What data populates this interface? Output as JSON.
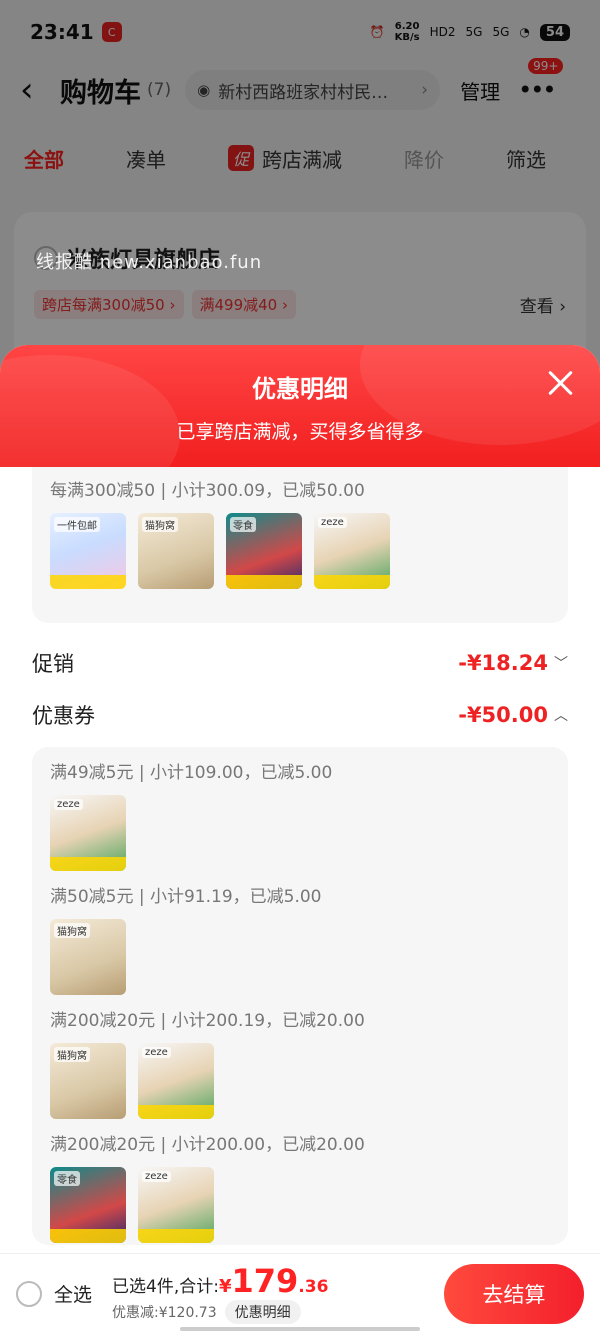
{
  "status_bar": {
    "time": "23:41",
    "app_badge": "C",
    "net_speed_top": "6.20",
    "net_speed_unit": "KB/s",
    "signal_1": "HD2",
    "signal_2": "5G",
    "signal_3": "5G",
    "battery": "54"
  },
  "header": {
    "title": "购物车",
    "count": "(7)",
    "address": "新村西路班家村村民…",
    "manage": "管理",
    "more_badge": "99+"
  },
  "tabs": [
    {
      "label": "全部"
    },
    {
      "label": "凑单"
    },
    {
      "label": "跨店满减",
      "tag": "促"
    },
    {
      "label": "降价"
    },
    {
      "label": "筛选"
    }
  ],
  "store": {
    "name": "米族灯具旗舰店",
    "tags": [
      "跨店每满300减50 ›",
      "满499减40 ›"
    ],
    "view_more": "查看 ›"
  },
  "watermark": "线报酷 new.xianbao.fun",
  "sheet": {
    "title": "优惠明细",
    "subtitle": "已享跨店满减，买得多省得多",
    "top_group": {
      "rule": "每满300减50 | 小计300.09，已减50.00",
      "thumbs": [
        {
          "kind": "tissue-pack-icon",
          "label": "一件包邮"
        },
        {
          "kind": "pet-house-icon",
          "label": "猫狗窝"
        },
        {
          "kind": "pet-snack-icon",
          "label": "零食"
        },
        {
          "kind": "deer-pet-bed-icon",
          "label": "zeze"
        }
      ]
    },
    "promo": {
      "label": "促销",
      "amount": "-¥18.24"
    },
    "coupon": {
      "label": "优惠券",
      "amount": "-¥50.00"
    },
    "coupon_groups": [
      {
        "rule": "满49减5元 | 小计109.00，已减5.00",
        "thumbs": [
          {
            "kind": "deer-pet-bed-icon",
            "label": "zeze"
          }
        ]
      },
      {
        "rule": "满50减5元 | 小计91.19，已减5.00",
        "thumbs": [
          {
            "kind": "pet-house-icon",
            "label": "猫狗窝"
          }
        ]
      },
      {
        "rule": "满200减20元 | 小计200.19，已减20.00",
        "thumbs": [
          {
            "kind": "pet-house-icon",
            "label": "猫狗窝"
          },
          {
            "kind": "deer-pet-bed-icon",
            "label": "zeze"
          }
        ]
      },
      {
        "rule": "满200减20元 | 小计200.00，已减20.00",
        "thumbs": [
          {
            "kind": "pet-snack-icon",
            "label": "零食"
          },
          {
            "kind": "deer-pet-bed-icon",
            "label": "zeze"
          }
        ]
      }
    ]
  },
  "bottom": {
    "select_all": "全选",
    "selected_total": "已选4件,合计:",
    "price_symbol": "¥",
    "price_int": "179",
    "price_dec": ".36",
    "discount": "优惠减:¥120.73",
    "detail_chip": "优惠明细",
    "checkout": "去结算"
  }
}
